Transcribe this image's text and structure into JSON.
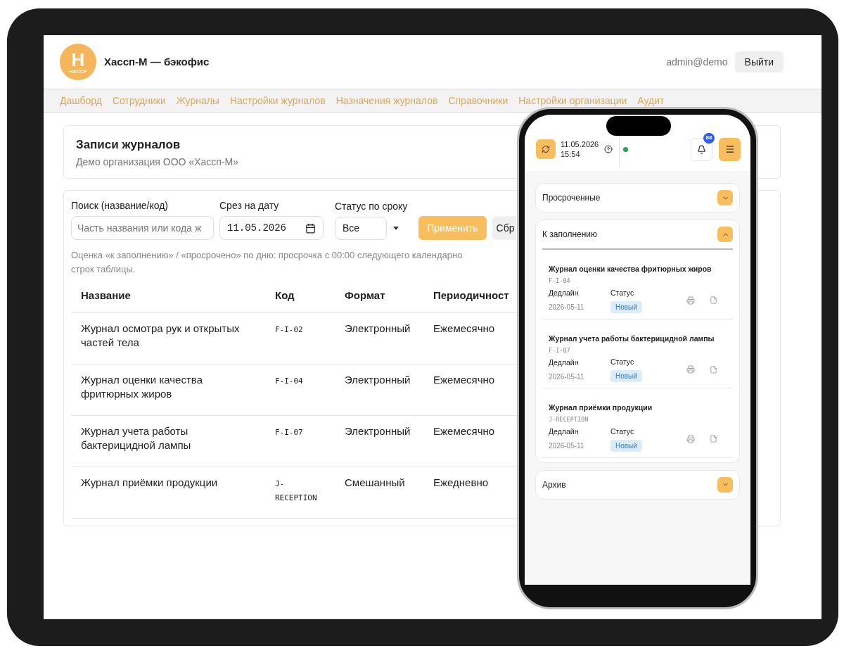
{
  "tablet": {
    "app_title": "Хассп-М — бэкофис",
    "logo_mark": "H",
    "logo_text": "HACCP",
    "user": "admin@demo",
    "logout": "Выйти",
    "nav": [
      {
        "label": "Дашборд",
        "selected": false
      },
      {
        "label": "Сотрудники",
        "selected": false
      },
      {
        "label": "Журналы",
        "selected": false
      },
      {
        "label": "Настройки журналов",
        "selected": false
      },
      {
        "label": "Назначения журналов",
        "selected": false
      },
      {
        "label": "Справочники",
        "selected": false
      },
      {
        "label": "Настройки организации",
        "selected": false
      },
      {
        "label": "Аудит",
        "selected": false
      }
    ],
    "page_title": "Записи журналов",
    "page_subtitle": "Демо организация ООО «Хассп-М»",
    "filters": {
      "search": {
        "label": "Поиск (название/код)",
        "placeholder": "Часть названия или кода ж"
      },
      "date": {
        "label": "Срез на дату",
        "value": "11.05.2026"
      },
      "status": {
        "label": "Статус по сроку",
        "value": "Все"
      },
      "apply": "Применить",
      "reset": "Сбр"
    },
    "hint": "Оценка «к заполнению» / «просрочено» по дню: просрочка с 00:00 следующего календарно",
    "hint_line_2": "строк таблицы.",
    "table": {
      "columns": [
        "Название",
        "Код",
        "Формат",
        "Периодичност"
      ],
      "rows": [
        {
          "name": "Журнал осмотра рук и открытых частей тела",
          "code": "F-I-02",
          "format": "Электронный",
          "period": "Ежемесячно"
        },
        {
          "name": "Журнал оценки качества фритюрных жиров",
          "code": "F-I-04",
          "format": "Электронный",
          "period": "Ежемесячно"
        },
        {
          "name": "Журнал учета работы бактерицидной лампы",
          "code": "F-I-07",
          "format": "Электронный",
          "period": "Ежемесячно"
        },
        {
          "name": "Журнал приёмки продукции",
          "code": "J-RECEPTION",
          "format": "Смешанный",
          "period": "Ежедневно"
        }
      ]
    }
  },
  "phone": {
    "date": "11.05.2026",
    "time": "15:54",
    "online": true,
    "notifications": "88",
    "sections": [
      {
        "title": "Просроченные",
        "expanded": false
      },
      {
        "title": "К заполнению",
        "expanded": true,
        "items": [
          {
            "title": "Журнал оценки качества фритюрных жиров",
            "code": "F-I-04",
            "deadline_label": "Дедлайн",
            "deadline": "2026-05-11",
            "status_label": "Статус",
            "status": "Новый"
          },
          {
            "title": "Журнал учета работы бактерицидной лампы",
            "code": "F-I-07",
            "deadline_label": "Дедлайн",
            "deadline": "2026-05-11",
            "status_label": "Статус",
            "status": "Новый"
          },
          {
            "title": "Журнал приёмки продукции",
            "code": "J-RECEPTION",
            "deadline_label": "Дедлайн",
            "deadline": "2026-05-11",
            "status_label": "Статус",
            "status": "Новый"
          }
        ]
      },
      {
        "title": "Архив",
        "expanded": false
      }
    ]
  }
}
